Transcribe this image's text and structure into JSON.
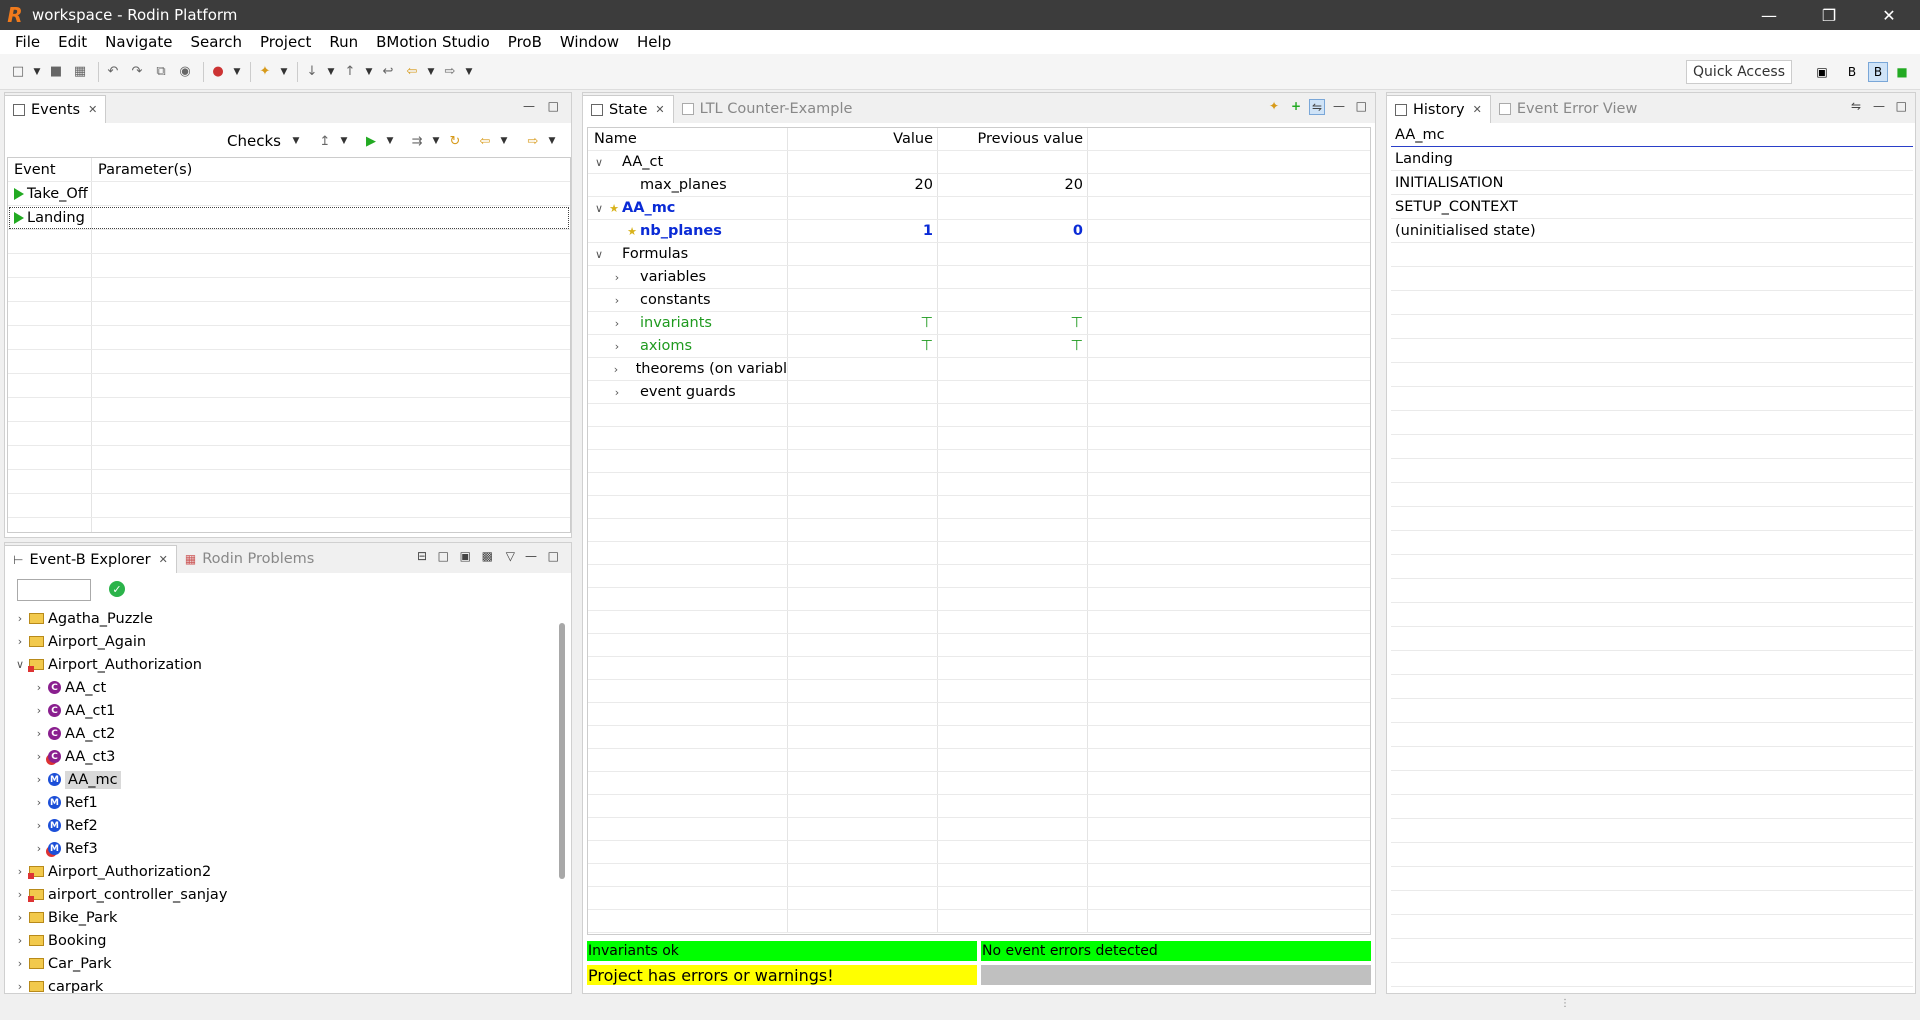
{
  "window": {
    "title": "workspace - Rodin Platform"
  },
  "menu": [
    "File",
    "Edit",
    "Navigate",
    "Search",
    "Project",
    "Run",
    "BMotion Studio",
    "ProB",
    "Window",
    "Help"
  ],
  "quick_access": "Quick Access",
  "events_panel": {
    "tab_label": "Events",
    "checks_label": "Checks",
    "columns": [
      "Event",
      "Parameter(s)"
    ],
    "rows": [
      {
        "event": "Take_Off",
        "params": ""
      },
      {
        "event": "Landing",
        "params": ""
      }
    ]
  },
  "explorer_panel": {
    "tab_label": "Event-B Explorer",
    "other_tab_label": "Rodin Problems",
    "filter_value": "",
    "items": [
      {
        "label": "Agatha_Puzzle",
        "kind": "project",
        "level": 0,
        "expanded": false,
        "error": false
      },
      {
        "label": "Airport_Again",
        "kind": "project",
        "level": 0,
        "expanded": false,
        "error": false
      },
      {
        "label": "Airport_Authorization",
        "kind": "project",
        "level": 0,
        "expanded": true,
        "error": true
      },
      {
        "label": "AA_ct",
        "kind": "context",
        "level": 1,
        "expanded": false,
        "error": false
      },
      {
        "label": "AA_ct1",
        "kind": "context",
        "level": 1,
        "expanded": false,
        "error": false
      },
      {
        "label": "AA_ct2",
        "kind": "context",
        "level": 1,
        "expanded": false,
        "error": false
      },
      {
        "label": "AA_ct3",
        "kind": "context",
        "level": 1,
        "expanded": false,
        "error": true
      },
      {
        "label": "AA_mc",
        "kind": "machine",
        "level": 1,
        "expanded": false,
        "error": false,
        "selected": true
      },
      {
        "label": "Ref1",
        "kind": "machine",
        "level": 1,
        "expanded": false,
        "error": false
      },
      {
        "label": "Ref2",
        "kind": "machine",
        "level": 1,
        "expanded": false,
        "error": false
      },
      {
        "label": "Ref3",
        "kind": "machine",
        "level": 1,
        "expanded": false,
        "error": true
      },
      {
        "label": "Airport_Authorization2",
        "kind": "project",
        "level": 0,
        "expanded": false,
        "error": true
      },
      {
        "label": "airport_controller_sanjay",
        "kind": "project",
        "level": 0,
        "expanded": false,
        "error": true
      },
      {
        "label": "Bike_Park",
        "kind": "project",
        "level": 0,
        "expanded": false,
        "error": false
      },
      {
        "label": "Booking",
        "kind": "project",
        "level": 0,
        "expanded": false,
        "error": false
      },
      {
        "label": "Car_Park",
        "kind": "project",
        "level": 0,
        "expanded": false,
        "error": false
      },
      {
        "label": "carpark",
        "kind": "project",
        "level": 0,
        "expanded": false,
        "error": false
      }
    ]
  },
  "state_panel": {
    "tab_label": "State",
    "other_tab_label": "LTL Counter-Example",
    "columns": [
      "Name",
      "Value",
      "Previous value"
    ],
    "rows": [
      {
        "name": "AA_ct",
        "value": "",
        "prev": "",
        "level": 0,
        "chev": "v",
        "style": "normal",
        "star": false
      },
      {
        "name": "max_planes",
        "value": "20",
        "prev": "20",
        "level": 1,
        "chev": "",
        "style": "normal",
        "star": false
      },
      {
        "name": "AA_mc",
        "value": "",
        "prev": "",
        "level": 0,
        "chev": "v",
        "style": "changed",
        "star": true
      },
      {
        "name": "nb_planes",
        "value": "1",
        "prev": "0",
        "level": 1,
        "chev": "",
        "style": "changed",
        "star": true
      },
      {
        "name": "Formulas",
        "value": "",
        "prev": "",
        "level": 0,
        "chev": "v",
        "style": "normal",
        "star": false
      },
      {
        "name": "variables",
        "value": "",
        "prev": "",
        "level": 1,
        "chev": ">",
        "style": "normal",
        "star": false
      },
      {
        "name": "constants",
        "value": "",
        "prev": "",
        "level": 1,
        "chev": ">",
        "style": "normal",
        "star": false
      },
      {
        "name": "invariants",
        "value": "⊤",
        "prev": "⊤",
        "level": 1,
        "chev": ">",
        "style": "ok",
        "star": false
      },
      {
        "name": "axioms",
        "value": "⊤",
        "prev": "⊤",
        "level": 1,
        "chev": ">",
        "style": "ok",
        "star": false
      },
      {
        "name": "theorems (on variabl",
        "value": "",
        "prev": "",
        "level": 1,
        "chev": ">",
        "style": "normal",
        "star": false
      },
      {
        "name": "event guards",
        "value": "",
        "prev": "",
        "level": 1,
        "chev": ">",
        "style": "normal",
        "star": false
      }
    ],
    "status": {
      "invariants": "Invariants ok",
      "event_errors": "No event errors detected",
      "project": "Project has errors or warnings!"
    }
  },
  "history_panel": {
    "tab_label": "History",
    "other_tab_label": "Event Error View",
    "items": [
      "AA_mc",
      "Landing",
      "INITIALISATION",
      "SETUP_CONTEXT",
      "(uninitialised state)"
    ]
  }
}
